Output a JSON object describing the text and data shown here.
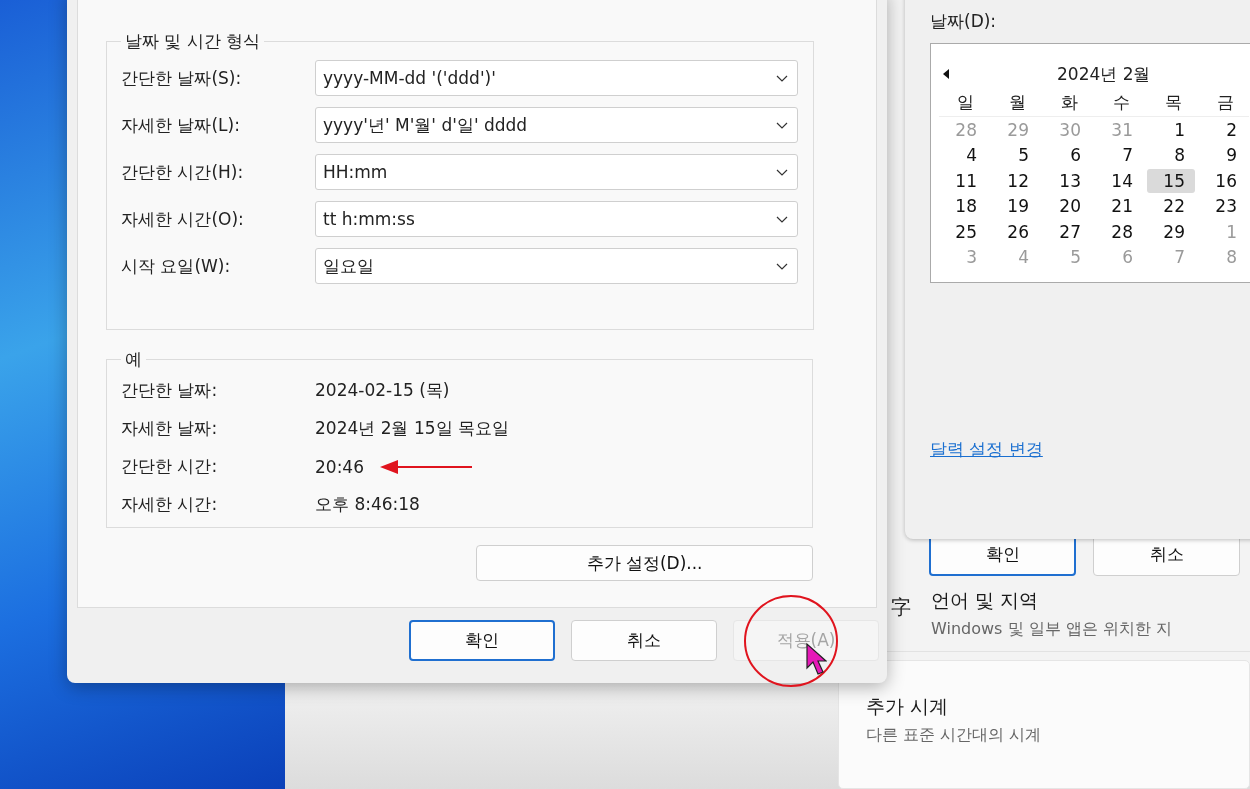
{
  "format_dialog": {
    "group_title": "날짜 및 시간 형식",
    "fields": [
      {
        "label": "간단한 날짜(S):",
        "value": "yyyy-MM-dd '('ddd')'"
      },
      {
        "label": "자세한 날짜(L):",
        "value": "yyyy'년' M'월' d'일' dddd"
      },
      {
        "label": "간단한 시간(H):",
        "value": "HH:mm"
      },
      {
        "label": "자세한 시간(O):",
        "value": "tt h:mm:ss"
      },
      {
        "label": "시작 요일(W):",
        "value": "일요일"
      }
    ],
    "example": {
      "title": "예",
      "rows": [
        {
          "label": "간단한 날짜:",
          "value": "2024-02-15 (목)",
          "arrow": false
        },
        {
          "label": "자세한 날짜:",
          "value": "2024년 2월 15일 목요일",
          "arrow": false
        },
        {
          "label": "간단한 시간:",
          "value": "20:46",
          "arrow": true
        },
        {
          "label": "자세한 시간:",
          "value": "오후 8:46:18",
          "arrow": false
        }
      ]
    },
    "more_button": "추가 설정(D)...",
    "buttons": [
      {
        "label": "확인",
        "default": true,
        "disabled": false,
        "circled": false
      },
      {
        "label": "취소",
        "default": false,
        "disabled": false,
        "circled": false
      },
      {
        "label": "적용(A)",
        "default": false,
        "disabled": true,
        "circled": true
      }
    ]
  },
  "date_dialog": {
    "label": "날짜(D):",
    "calendar": {
      "month": "2024년 2월",
      "weekdays": [
        "일",
        "월",
        "화",
        "수",
        "목",
        "금"
      ],
      "weeks": [
        [
          {
            "day": "28",
            "other_month": true,
            "selected": false
          },
          {
            "day": "29",
            "other_month": true,
            "selected": false
          },
          {
            "day": "30",
            "other_month": true,
            "selected": false
          },
          {
            "day": "31",
            "other_month": true,
            "selected": false
          },
          {
            "day": "1",
            "other_month": false,
            "selected": false
          },
          {
            "day": "2",
            "other_month": false,
            "selected": false
          }
        ],
        [
          {
            "day": "4",
            "other_month": false,
            "selected": false
          },
          {
            "day": "5",
            "other_month": false,
            "selected": false
          },
          {
            "day": "6",
            "other_month": false,
            "selected": false
          },
          {
            "day": "7",
            "other_month": false,
            "selected": false
          },
          {
            "day": "8",
            "other_month": false,
            "selected": false
          },
          {
            "day": "9",
            "other_month": false,
            "selected": false
          }
        ],
        [
          {
            "day": "11",
            "other_month": false,
            "selected": false
          },
          {
            "day": "12",
            "other_month": false,
            "selected": false
          },
          {
            "day": "13",
            "other_month": false,
            "selected": false
          },
          {
            "day": "14",
            "other_month": false,
            "selected": false
          },
          {
            "day": "15",
            "other_month": false,
            "selected": true
          },
          {
            "day": "16",
            "other_month": false,
            "selected": false
          }
        ],
        [
          {
            "day": "18",
            "other_month": false,
            "selected": false
          },
          {
            "day": "19",
            "other_month": false,
            "selected": false
          },
          {
            "day": "20",
            "other_month": false,
            "selected": false
          },
          {
            "day": "21",
            "other_month": false,
            "selected": false
          },
          {
            "day": "22",
            "other_month": false,
            "selected": false
          },
          {
            "day": "23",
            "other_month": false,
            "selected": false
          }
        ],
        [
          {
            "day": "25",
            "other_month": false,
            "selected": false
          },
          {
            "day": "26",
            "other_month": false,
            "selected": false
          },
          {
            "day": "27",
            "other_month": false,
            "selected": false
          },
          {
            "day": "28",
            "other_month": false,
            "selected": false
          },
          {
            "day": "29",
            "other_month": false,
            "selected": false
          },
          {
            "day": "1",
            "other_month": true,
            "selected": false
          }
        ],
        [
          {
            "day": "3",
            "other_month": true,
            "selected": false
          },
          {
            "day": "4",
            "other_month": true,
            "selected": false
          },
          {
            "day": "5",
            "other_month": true,
            "selected": false
          },
          {
            "day": "6",
            "other_month": true,
            "selected": false
          },
          {
            "day": "7",
            "other_month": true,
            "selected": false
          },
          {
            "day": "8",
            "other_month": true,
            "selected": false
          }
        ]
      ]
    },
    "link": "달력 설정 변경"
  },
  "settings_window": {
    "buttons": [
      {
        "label": "확인",
        "default": true
      },
      {
        "label": "취소",
        "default": false
      }
    ],
    "items": [
      {
        "kind": "row",
        "icon": "字",
        "title": "언어 및 지역",
        "description": "Windows 및 일부 앱은 위치한 지"
      },
      {
        "kind": "card",
        "title": "추가 시계",
        "description": "다른 표준 시간대의 시계"
      }
    ]
  }
}
